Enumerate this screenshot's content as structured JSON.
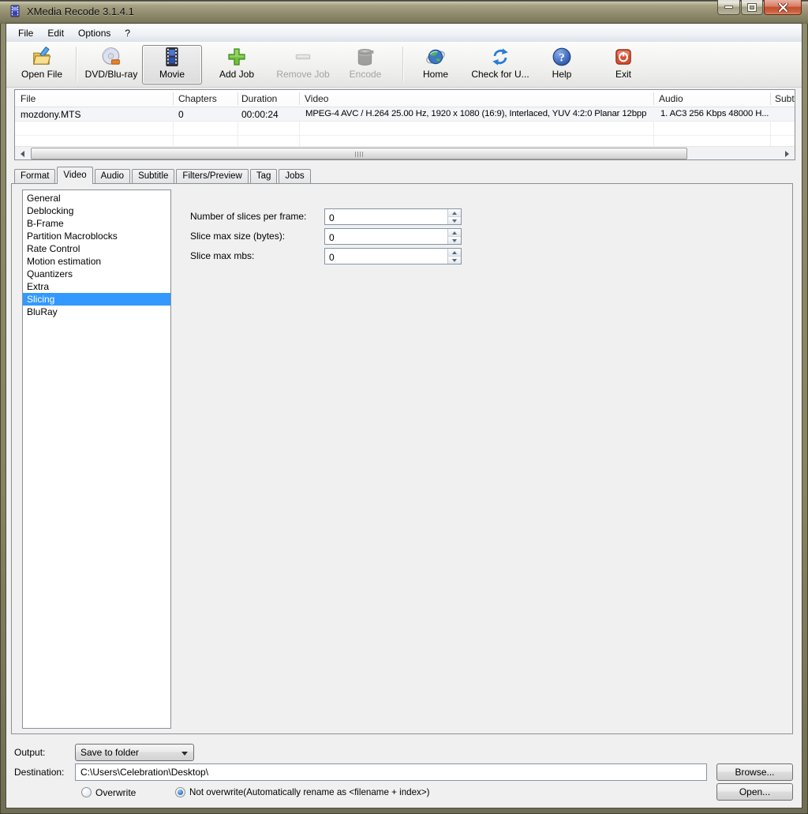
{
  "window": {
    "title": "XMedia Recode 3.1.4.1"
  },
  "menu": {
    "items": [
      {
        "label": "File"
      },
      {
        "label": "Edit"
      },
      {
        "label": "Options"
      },
      {
        "label": "?"
      }
    ]
  },
  "toolbar": {
    "buttons": [
      {
        "label": "Open File",
        "icon": "open-file-icon",
        "state": "normal"
      },
      {
        "label": "DVD/Blu-ray",
        "icon": "dvd-icon",
        "state": "normal"
      },
      {
        "label": "Movie",
        "icon": "movie-icon",
        "state": "selected"
      },
      {
        "label": "Add Job",
        "icon": "add-job-icon",
        "state": "normal"
      },
      {
        "label": "Remove Job",
        "icon": "remove-job-icon",
        "state": "disabled"
      },
      {
        "label": "Encode",
        "icon": "encode-icon",
        "state": "disabled"
      },
      {
        "label": "Home",
        "icon": "home-icon",
        "state": "normal"
      },
      {
        "label": "Check for U...",
        "icon": "check-update-icon",
        "state": "normal"
      },
      {
        "label": "Help",
        "icon": "help-icon",
        "state": "normal"
      },
      {
        "label": "Exit",
        "icon": "exit-icon",
        "state": "normal"
      }
    ]
  },
  "filelist": {
    "columns": [
      "File",
      "Chapters",
      "Duration",
      "Video",
      "Audio",
      "Subt"
    ],
    "rows": [
      {
        "file": "mozdony.MTS",
        "chapters": "0",
        "duration": "00:00:24",
        "video": "MPEG-4 AVC / H.264 25.00 Hz, 1920 x 1080 (16:9), Interlaced, YUV 4:2:0 Planar 12bpp",
        "audio": "1. AC3 256 Kbps 48000 H..."
      }
    ]
  },
  "tabs": {
    "items": [
      "Format",
      "Video",
      "Audio",
      "Subtitle",
      "Filters/Preview",
      "Tag",
      "Jobs"
    ],
    "active": "Video"
  },
  "video_settings": {
    "sections": [
      "General",
      "Deblocking",
      "B-Frame",
      "Partition Macroblocks",
      "Rate Control",
      "Motion estimation",
      "Quantizers",
      "Extra",
      "Slicing",
      "BluRay"
    ],
    "selected": "Slicing"
  },
  "slicing_form": {
    "fields": [
      {
        "label": "Number of slices per frame:",
        "value": "0"
      },
      {
        "label": "Slice max size (bytes):",
        "value": "0"
      },
      {
        "label": "Slice max mbs:",
        "value": "0"
      }
    ]
  },
  "output_bar": {
    "output_label": "Output:",
    "output_value": "Save to folder",
    "destination_label": "Destination:",
    "destination_value": "C:\\Users\\Celebration\\Desktop\\",
    "browse_label": "Browse...",
    "open_label": "Open...",
    "radios": [
      {
        "label": "Overwrite",
        "selected": false
      },
      {
        "label": "Not overwrite(Automatically rename as <filename + index>)",
        "selected": true
      }
    ]
  },
  "icons": {
    "help_glyph": "?"
  },
  "colors": {
    "selection": "#3399ff",
    "titlebar_frame": "#8b8769",
    "close_button": "#c1502f"
  }
}
